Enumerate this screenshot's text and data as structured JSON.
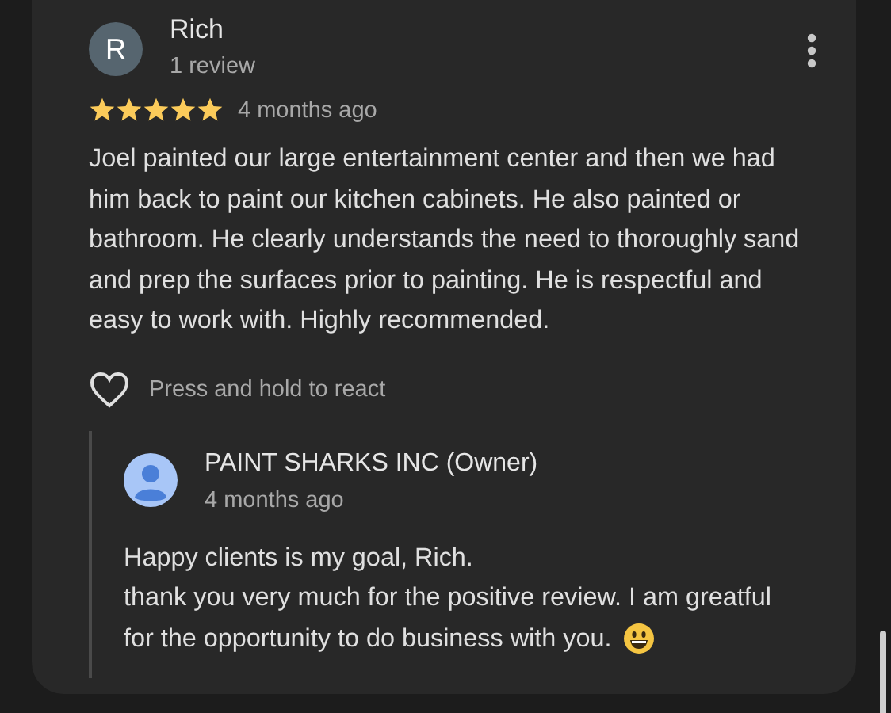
{
  "review": {
    "avatar_letter": "R",
    "author": "Rich",
    "author_meta": "1 review",
    "stars": 5,
    "time": "4 months ago",
    "text": "Joel painted our large entertainment center and then we had him back to paint our kitchen cabinets. He also painted or bathroom. He clearly understands the need to thoroughly sand and prep the surfaces prior to painting. He is respectful and easy to work with. Highly recommended.",
    "react_hint": "Press and hold to react"
  },
  "owner_reply": {
    "author": "PAINT SHARKS INC (Owner)",
    "time": "4 months ago",
    "text_lines": [
      "Happy clients is my goal, Rich.",
      "thank you very much for the positive review. I am greatful",
      "for the opportunity to do business with you."
    ]
  }
}
